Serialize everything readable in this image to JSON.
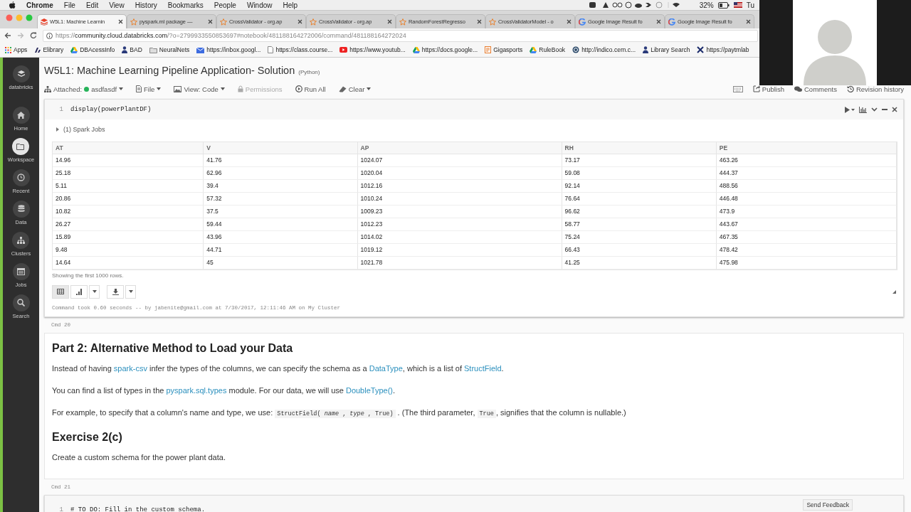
{
  "menubar": {
    "app": "Chrome",
    "menus": [
      "File",
      "Edit",
      "View",
      "History",
      "Bookmarks",
      "People",
      "Window",
      "Help"
    ],
    "battery": "32%",
    "clock": "Tu"
  },
  "tabs": [
    {
      "title": "W5L1: Machine Learnin",
      "kind": "databricks",
      "selected": true
    },
    {
      "title": "pyspark.ml package —",
      "kind": "star",
      "selected": false
    },
    {
      "title": "CrossValidator - org.ap",
      "kind": "star",
      "selected": false
    },
    {
      "title": "CrossValidator - org.ap",
      "kind": "star",
      "selected": false
    },
    {
      "title": "RandomForestRegresso",
      "kind": "star",
      "selected": false
    },
    {
      "title": "CrossValidatorModel - o",
      "kind": "star",
      "selected": false
    },
    {
      "title": "Google Image Result fo",
      "kind": "google",
      "selected": false
    },
    {
      "title": "Google Image Result fo",
      "kind": "google",
      "selected": false
    }
  ],
  "address_bar": {
    "scheme": "https://",
    "host": "community.cloud.databricks.com",
    "rest": "/?o=2799933550853697#notebook/481188164272006/command/481188164272024"
  },
  "bookmarks": [
    {
      "label": "Apps",
      "kind": "apps"
    },
    {
      "label": "Elibrary",
      "kind": "book"
    },
    {
      "label": "DBAcessInfo",
      "kind": "drive"
    },
    {
      "label": "BAD",
      "kind": "figure"
    },
    {
      "label": "NeuralNets",
      "kind": "folder"
    },
    {
      "label": "https://inbox.googl...",
      "kind": "mail"
    },
    {
      "label": "https://class.course...",
      "kind": "page"
    },
    {
      "label": "https://www.youtub...",
      "kind": "video"
    },
    {
      "label": "https://docs.google...",
      "kind": "drive"
    },
    {
      "label": "Gigasports",
      "kind": "gift"
    },
    {
      "label": "RuleBook",
      "kind": "drive"
    },
    {
      "label": "http://indico.cern.c...",
      "kind": "globe"
    },
    {
      "label": "Library Search",
      "kind": "figure"
    },
    {
      "label": "https://paytmlab",
      "kind": "cross"
    }
  ],
  "sidebar": {
    "logo": "databricks",
    "items": [
      {
        "label": "Home",
        "kind": "home",
        "selected": false
      },
      {
        "label": "Workspace",
        "kind": "folder",
        "selected": true
      },
      {
        "label": "Recent",
        "kind": "clock",
        "selected": false
      },
      {
        "label": "Data",
        "kind": "data",
        "selected": false
      },
      {
        "label": "Clusters",
        "kind": "clusters",
        "selected": false
      },
      {
        "label": "Jobs",
        "kind": "calendar",
        "selected": false
      },
      {
        "label": "Search",
        "kind": "search",
        "selected": false
      }
    ]
  },
  "notebook": {
    "title": "W5L1: Machine Learning Pipeline Application- Solution",
    "language": "(Python)",
    "toolbar": [
      {
        "kind": "cluster",
        "label": "Attached:",
        "value": "asdfasdf",
        "color": "#27b35a",
        "menu": true,
        "disabled": false
      },
      {
        "kind": "file",
        "label": "File",
        "menu": true,
        "disabled": false
      },
      {
        "kind": "view",
        "label": "View: Code",
        "menu": true,
        "disabled": false
      },
      {
        "kind": "permissions",
        "label": "Permissions",
        "menu": false,
        "disabled": true
      },
      {
        "kind": "run",
        "label": "Run All",
        "menu": false,
        "disabled": false
      },
      {
        "kind": "clear",
        "label": "Clear",
        "menu": true,
        "disabled": false
      }
    ],
    "actions": [
      {
        "kind": "keyboard"
      },
      {
        "kind": "publish",
        "label": "Publish"
      },
      {
        "kind": "comments",
        "label": "Comments"
      },
      {
        "kind": "history",
        "label": "Revision history"
      }
    ]
  },
  "result_cell": {
    "lines": [
      {
        "number": "1",
        "code": "display(powerPlantDF)"
      }
    ],
    "jobs": "(1) Spark Jobs",
    "table": {
      "columns": [
        "AT",
        "V",
        "AP",
        "RH",
        "PE"
      ],
      "rows": [
        [
          "14.96",
          "41.76",
          "1024.07",
          "73.17",
          "463.26"
        ],
        [
          "25.18",
          "62.96",
          "1020.04",
          "59.08",
          "444.37"
        ],
        [
          "5.11",
          "39.4",
          "1012.16",
          "92.14",
          "488.56"
        ],
        [
          "20.86",
          "57.32",
          "1010.24",
          "76.64",
          "446.48"
        ],
        [
          "10.82",
          "37.5",
          "1009.23",
          "96.62",
          "473.9"
        ],
        [
          "26.27",
          "59.44",
          "1012.23",
          "58.77",
          "443.67"
        ],
        [
          "15.89",
          "43.96",
          "1014.02",
          "75.24",
          "467.35"
        ],
        [
          "9.48",
          "44.71",
          "1019.12",
          "66.43",
          "478.42"
        ],
        [
          "14.64",
          "45",
          "1021.78",
          "41.25",
          "475.98"
        ]
      ]
    },
    "row_note": "Showing the first 1000 rows.",
    "view_buttons": [
      {
        "kind": "table",
        "selected": true
      },
      {
        "kind": "chart",
        "selected": false
      }
    ],
    "footer": "Command took 0.60 seconds -- by jabenite@gmail.com at 7/30/2017, 12:11:46 AM on My Cluster"
  },
  "cmd_label_1": "Cmd 20",
  "markdown_cell": {
    "blocks": [
      {
        "kind": "h2",
        "segments": [
          {
            "kind": "text",
            "text": "Part 2: Alternative Method to Load your Data"
          }
        ]
      },
      {
        "kind": "p",
        "segments": [
          {
            "kind": "text",
            "text": "Instead of having "
          },
          {
            "kind": "link",
            "text": "spark-csv"
          },
          {
            "kind": "text",
            "text": " infer the types of the columns, we can specify the schema as a "
          },
          {
            "kind": "link",
            "text": "DataType"
          },
          {
            "kind": "text",
            "text": ", which is a list of "
          },
          {
            "kind": "link",
            "text": "StructField"
          },
          {
            "kind": "text",
            "text": "."
          }
        ]
      },
      {
        "kind": "p",
        "segments": [
          {
            "kind": "text",
            "text": "You can find a list of types in the "
          },
          {
            "kind": "link",
            "text": "pyspark.sql.types"
          },
          {
            "kind": "text",
            "text": " module. For our data, we will use "
          },
          {
            "kind": "link",
            "text": "DoubleType()"
          },
          {
            "kind": "text",
            "text": "."
          }
        ]
      },
      {
        "kind": "p",
        "segments": [
          {
            "kind": "text",
            "text": "For example, to specify that a column's name and type, we use: "
          },
          {
            "kind": "code",
            "text": "StructField( *name* , *type* , True)"
          },
          {
            "kind": "text",
            "text": " . (The third parameter, "
          },
          {
            "kind": "code",
            "text": "True"
          },
          {
            "kind": "text",
            "text": ", signifies that the column is nullable.)"
          }
        ]
      },
      {
        "kind": "h2",
        "segments": [
          {
            "kind": "text",
            "text": "Exercise 2(c)"
          }
        ]
      },
      {
        "kind": "p",
        "segments": [
          {
            "kind": "text",
            "text": "Create a custom schema for the power plant data."
          }
        ]
      }
    ]
  },
  "cmd_label_2": "Cmd 21",
  "todo_cell": {
    "lines": [
      {
        "number": "1",
        "code": "# TO DO: Fill in the custom schema."
      }
    ]
  },
  "feedback_button": "Send Feedback"
}
